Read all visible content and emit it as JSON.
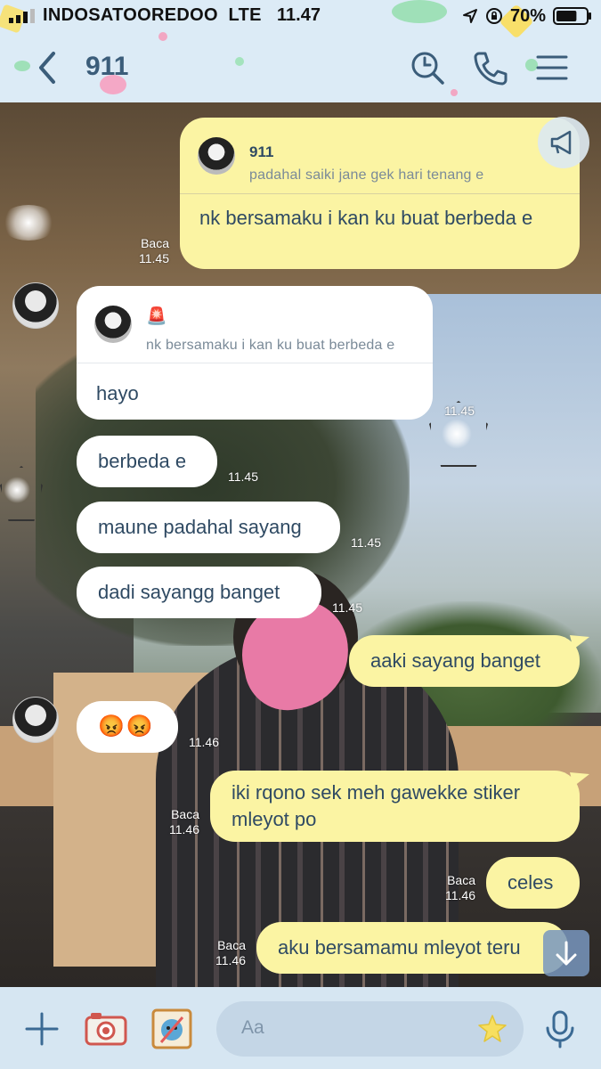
{
  "status_bar": {
    "carrier": "INDOSATOOREDOO",
    "network": "LTE",
    "time": "11.47",
    "battery_percent": "70%",
    "battery_level": 0.7
  },
  "header": {
    "title": "911",
    "icons": [
      "back-arrow-icon",
      "search-icon",
      "phone-icon",
      "menu-icon"
    ]
  },
  "messages": [
    {
      "side": "me",
      "reply_name": "911",
      "reply_text": "padahal saiki jane gek hari tenang e",
      "text": "nk bersamaku i kan ku buat berbeda e",
      "read": "Baca",
      "time": "11.45"
    },
    {
      "side": "them",
      "reply_emoji": "🚨",
      "reply_text": "nk bersamaku i kan ku buat berbeda e",
      "text": "hayo",
      "time": "11.45"
    },
    {
      "side": "them",
      "text": "berbeda e",
      "time": "11.45"
    },
    {
      "side": "them",
      "text": "maune padahal sayang",
      "time": "11.45"
    },
    {
      "side": "them",
      "text": "dadi sayangg banget",
      "time": "11.45"
    },
    {
      "side": "me",
      "text": "aaki sayang banget",
      "read": "",
      "time": ""
    },
    {
      "side": "them",
      "text": "😡😡",
      "time": "11.46"
    },
    {
      "side": "me",
      "text": "iki rqono sek meh gawekke stiker mleyot po",
      "read": "Baca",
      "time": "11.46"
    },
    {
      "side": "me",
      "text": "celes",
      "read": "Baca",
      "time": "11.46"
    },
    {
      "side": "me",
      "text": "aku bersamamu mleyot teru",
      "read": "Baca",
      "time": "11.46"
    }
  ],
  "input": {
    "placeholder": "Aa"
  },
  "colors": {
    "me_bubble": "#fbf4a3",
    "them_bubble": "#ffffff",
    "bubble_text": "#2f4a63",
    "header_bg": "#dcebf6"
  }
}
